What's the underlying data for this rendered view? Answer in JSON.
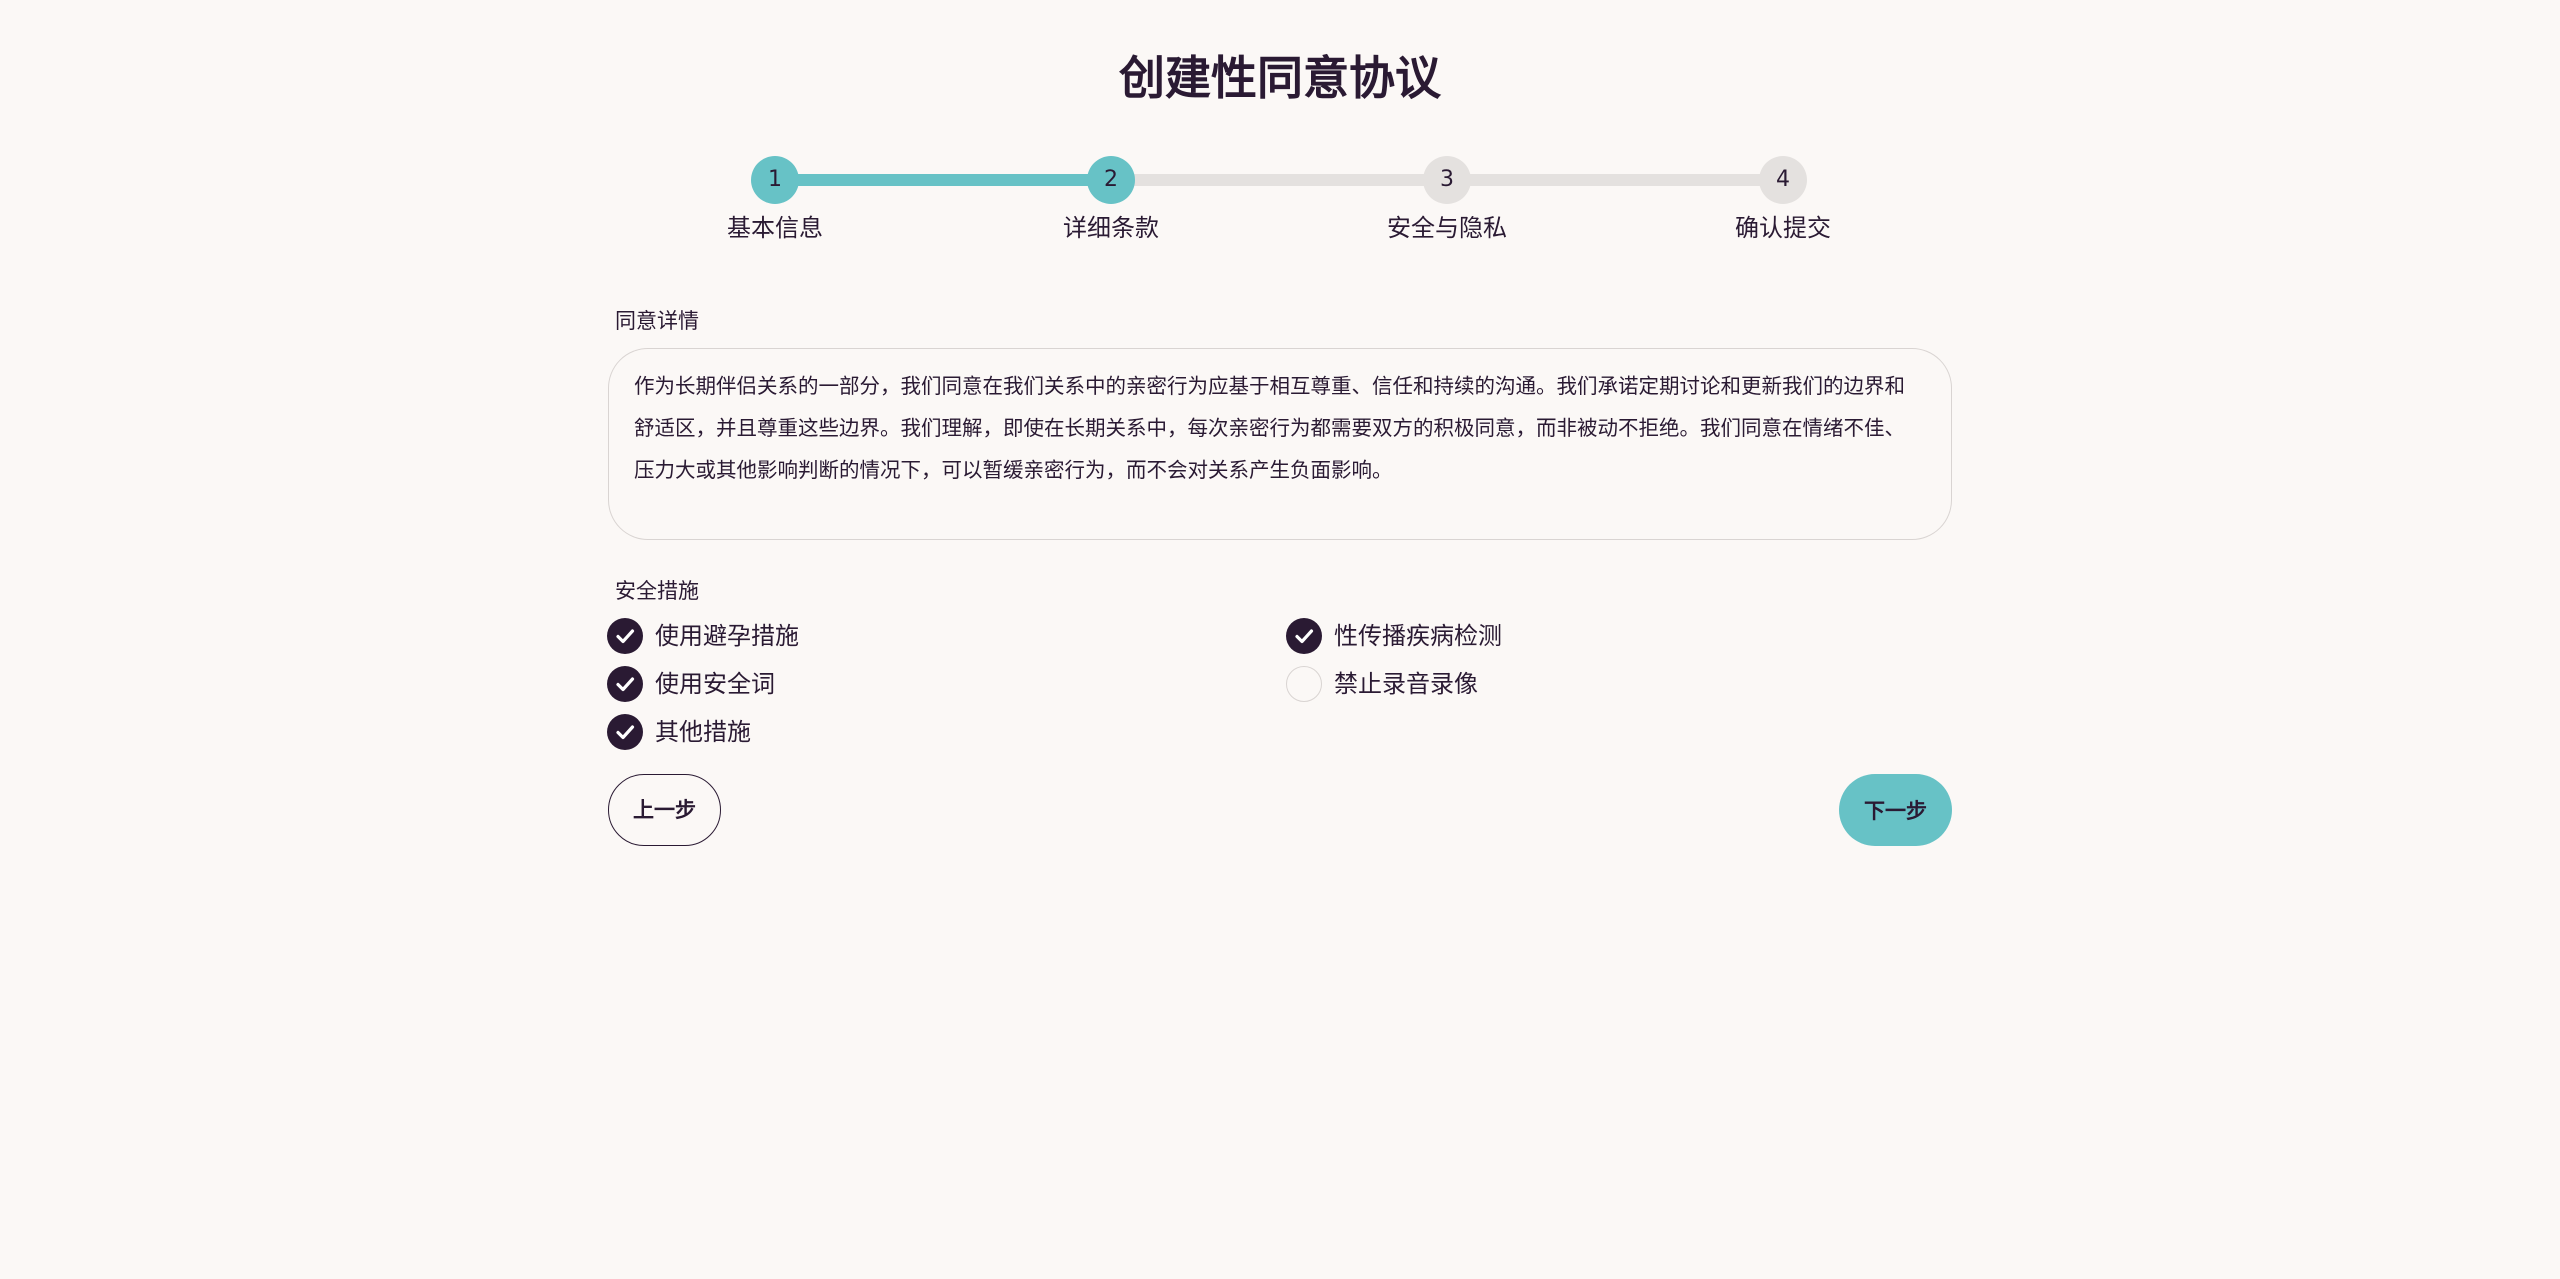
{
  "page": {
    "title": "创建性同意协议"
  },
  "stepper": {
    "current_step": 2,
    "steps": [
      {
        "number": "1",
        "label": "基本信息",
        "state": "completed"
      },
      {
        "number": "2",
        "label": "详细条款",
        "state": "active"
      },
      {
        "number": "3",
        "label": "安全与隐私",
        "state": "pending"
      },
      {
        "number": "4",
        "label": "确认提交",
        "state": "pending"
      }
    ]
  },
  "consent": {
    "label": "同意详情",
    "text": "作为长期伴侣关系的一部分，我们同意在我们关系中的亲密行为应基于相互尊重、信任和持续的沟通。我们承诺定期讨论和更新我们的边界和舒适区，并且尊重这些边界。我们理解，即使在长期关系中，每次亲密行为都需要双方的积极同意，而非被动不拒绝。我们同意在情绪不佳、压力大或其他影响判断的情况下，可以暂缓亲密行为，而不会对关系产生负面影响。"
  },
  "safety": {
    "label": "安全措施",
    "options": [
      {
        "label": "使用避孕措施",
        "checked": true
      },
      {
        "label": "性传播疾病检测",
        "checked": true
      },
      {
        "label": "使用安全词",
        "checked": true
      },
      {
        "label": "禁止录音录像",
        "checked": false
      },
      {
        "label": "其他措施",
        "checked": true
      }
    ]
  },
  "nav": {
    "prev_label": "上一步",
    "next_label": "下一步"
  },
  "colors": {
    "accent": "#67c2c6",
    "text": "#2a1a33",
    "background": "#fbf8f6",
    "inactive": "#e4e1df"
  }
}
